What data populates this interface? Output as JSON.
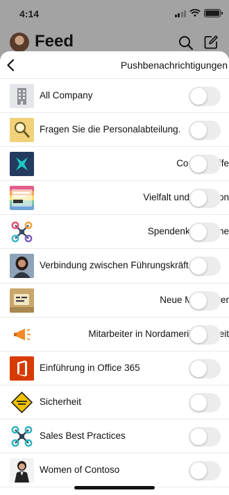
{
  "status_bar": {
    "time": "4:14"
  },
  "feed": {
    "title": "Feed"
  },
  "sheet": {
    "title": "Pushbenachrichtigungen"
  },
  "items": [
    {
      "label": "All Company",
      "icon": "building-icon",
      "enabled": false
    },
    {
      "label": "Fragen Sie die Personalabteilung.",
      "icon": "magnifier-icon",
      "enabled": false
    },
    {
      "label": "Contoso Life",
      "icon": "contoso-logo-icon",
      "enabled": false
    },
    {
      "label": "Vielfalt und Inklusion",
      "icon": "all-are-welcome-icon",
      "enabled": false
    },
    {
      "label": "Spendenkampagne",
      "icon": "network-hub-icon",
      "enabled": false
    },
    {
      "label": "Verbindung zwischen Führungskräften",
      "icon": "person-photo-icon",
      "enabled": false
    },
    {
      "label": "Neue Mitarbeiter",
      "icon": "new-badge-photo-icon",
      "enabled": false
    },
    {
      "label": "Mitarbeiter in Nordamerika schreit",
      "icon": "megaphone-icon",
      "enabled": false
    },
    {
      "label": "Einführung in Office 365",
      "icon": "office-logo-icon",
      "enabled": false
    },
    {
      "label": "Sicherheit",
      "icon": "safety-first-sign-icon",
      "enabled": false
    },
    {
      "label": "Sales Best Practices",
      "icon": "network-hub-teal-icon",
      "enabled": false
    },
    {
      "label": "Women of Contoso",
      "icon": "woman-photo-icon",
      "enabled": false
    }
  ],
  "colors": {
    "toggle_off": "#ececec",
    "office_orange": "#d83b01",
    "contoso_navy": "#243a5e",
    "contoso_teal": "#1ec8c2"
  }
}
